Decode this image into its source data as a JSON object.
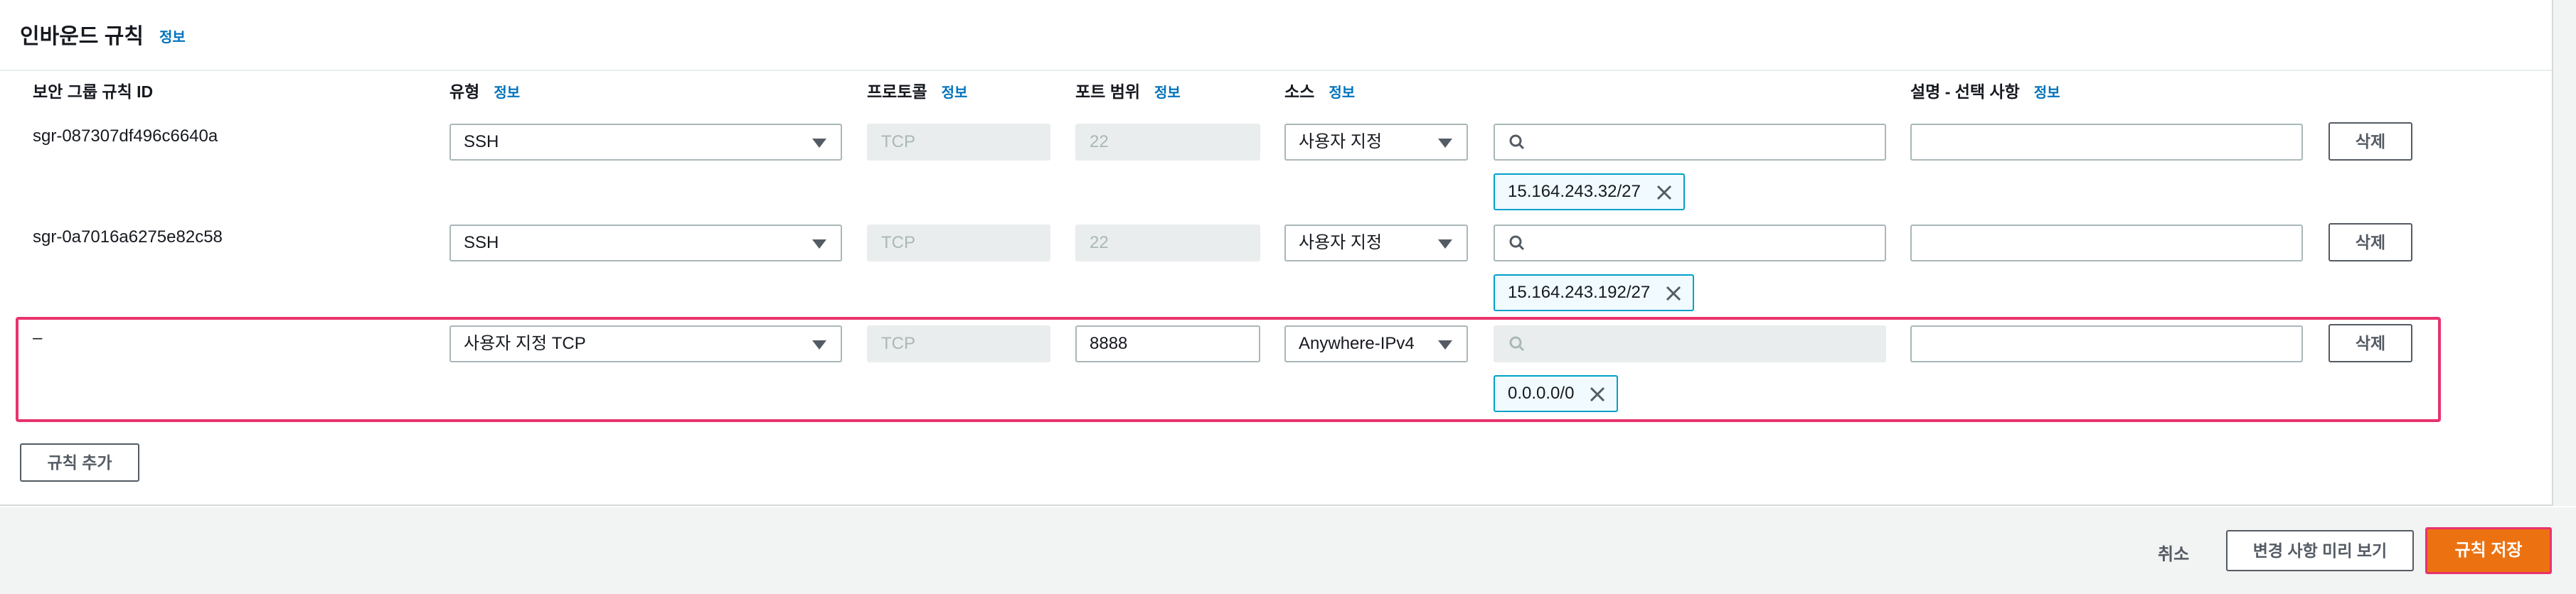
{
  "section": {
    "title": "인바운드 규칙",
    "info_label": "정보"
  },
  "columns": {
    "rule_id": "보안 그룹 규칙 ID",
    "type": "유형",
    "protocol": "프로토콜",
    "port_range": "포트 범위",
    "source": "소스",
    "description": "설명 - 선택 사항",
    "info_label": "정보"
  },
  "rules": [
    {
      "id": "sgr-087307df496c6640a",
      "type": "SSH",
      "protocol": "TCP",
      "port_range": "22",
      "source_type": "사용자 지정",
      "search_value": "",
      "cidr_token": "15.164.243.32/27",
      "description": "",
      "delete_label": "삭제"
    },
    {
      "id": "sgr-0a7016a6275e82c58",
      "type": "SSH",
      "protocol": "TCP",
      "port_range": "22",
      "source_type": "사용자 지정",
      "search_value": "",
      "cidr_token": "15.164.243.192/27",
      "description": "",
      "delete_label": "삭제"
    },
    {
      "id": "–",
      "type": "사용자 지정 TCP",
      "protocol": "TCP",
      "port_range": "8888",
      "source_type": "Anywhere-IPv4",
      "search_value": "",
      "cidr_token": "0.0.0.0/0",
      "description": "",
      "delete_label": "삭제"
    }
  ],
  "add_rule_label": "규칙 추가",
  "footer": {
    "cancel_label": "취소",
    "preview_label": "변경 사항 미리 보기",
    "save_label": "규칙 저장"
  },
  "colors": {
    "accent": "#ec7211",
    "link": "#0073bb",
    "highlight": "#e8336d",
    "token_border": "#00a1c9"
  }
}
